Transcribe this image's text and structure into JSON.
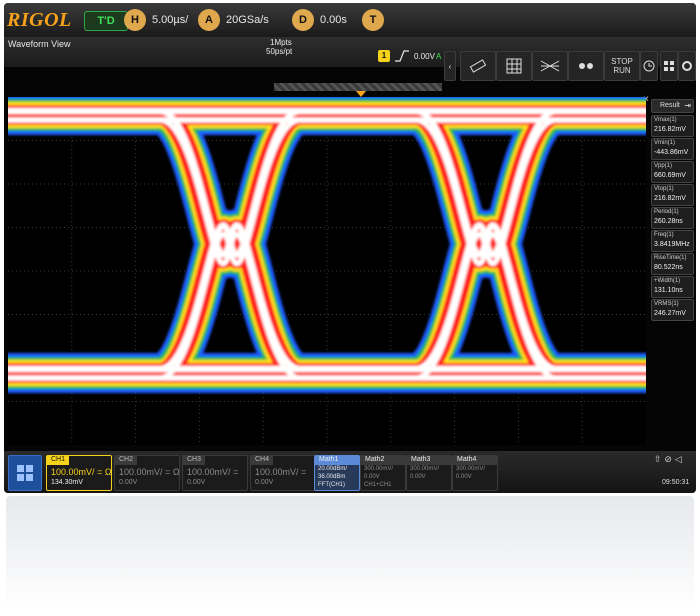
{
  "brand": "RIGOL",
  "top_bar": {
    "run_mode": "T'D",
    "horizontal": {
      "icon_letter": "H",
      "value": "5.00µs/"
    },
    "acquire": {
      "icon_letter": "A",
      "sample_rate": "20GSa/s",
      "memory_depth": "1Mpts",
      "resolution": "50ps/pt"
    },
    "delay": {
      "icon_letter": "D",
      "value": "0.00s"
    },
    "trigger": {
      "icon_letter": "T",
      "source": "1",
      "level": "0.00V",
      "mode": "A"
    }
  },
  "window_title": "Waveform View",
  "toolbar": {
    "stop_run_label_top": "STOP",
    "stop_run_label_bottom": "RUN"
  },
  "result_panel": {
    "title": "Result",
    "measurements": [
      {
        "label": "Vmax(1)",
        "value": "216.82mV"
      },
      {
        "label": "Vmin(1)",
        "value": "-443.86mV"
      },
      {
        "label": "Vpp(1)",
        "value": "660.69mV"
      },
      {
        "label": "Vtop(1)",
        "value": "216.82mV"
      },
      {
        "label": "Period(1)",
        "value": "260.28ns"
      },
      {
        "label": "Freq(1)",
        "value": "3.8419MHz"
      },
      {
        "label": "RiseTime(1)",
        "value": "80.522ns"
      },
      {
        "label": "+Width(1)",
        "value": "131.10ns"
      },
      {
        "label": "VRMS(1)",
        "value": "246.27mV"
      }
    ]
  },
  "channels": [
    {
      "name": "CH1",
      "scale": "100.00mV/",
      "coupling": "=",
      "impedance": "Ω",
      "offset": "134.30mV",
      "color": "#f7d21a",
      "active": true
    },
    {
      "name": "CH2",
      "scale": "100.00mV/",
      "coupling": "=",
      "impedance": "Ω",
      "offset": "0.00V",
      "color": "#8a8a8a",
      "active": false
    },
    {
      "name": "CH3",
      "scale": "100.00mV/",
      "coupling": "=",
      "impedance": "",
      "offset": "0.00V",
      "color": "#8a8a8a",
      "active": false
    },
    {
      "name": "CH4",
      "scale": "100.00mV/",
      "coupling": "=",
      "impedance": "",
      "offset": "0.00V",
      "color": "#8a8a8a",
      "active": false
    }
  ],
  "maths": [
    {
      "name": "Math1",
      "line1": "20.00dBm/",
      "line2": "36.00dBm",
      "line3": "FFT(CH1)",
      "active": true
    },
    {
      "name": "Math2",
      "line1": "300.00mV/",
      "line2": "0.00V",
      "line3": "CH1+CH1",
      "active": false
    },
    {
      "name": "Math3",
      "line1": "300.00mV/",
      "line2": "0.00V",
      "line3": "",
      "active": false
    },
    {
      "name": "Math4",
      "line1": "300.00mV/",
      "line2": "0.00V",
      "line3": "",
      "active": false
    }
  ],
  "status": {
    "time": "09:50:31"
  },
  "colors": {
    "accent": "#f7a21a",
    "trace_hot": "#ffffff",
    "trace_warm": "#ff1a1a",
    "trace_mid": "#ffe21a",
    "trace_cool": "#1ab84a",
    "trace_cold": "#1a5aff"
  }
}
